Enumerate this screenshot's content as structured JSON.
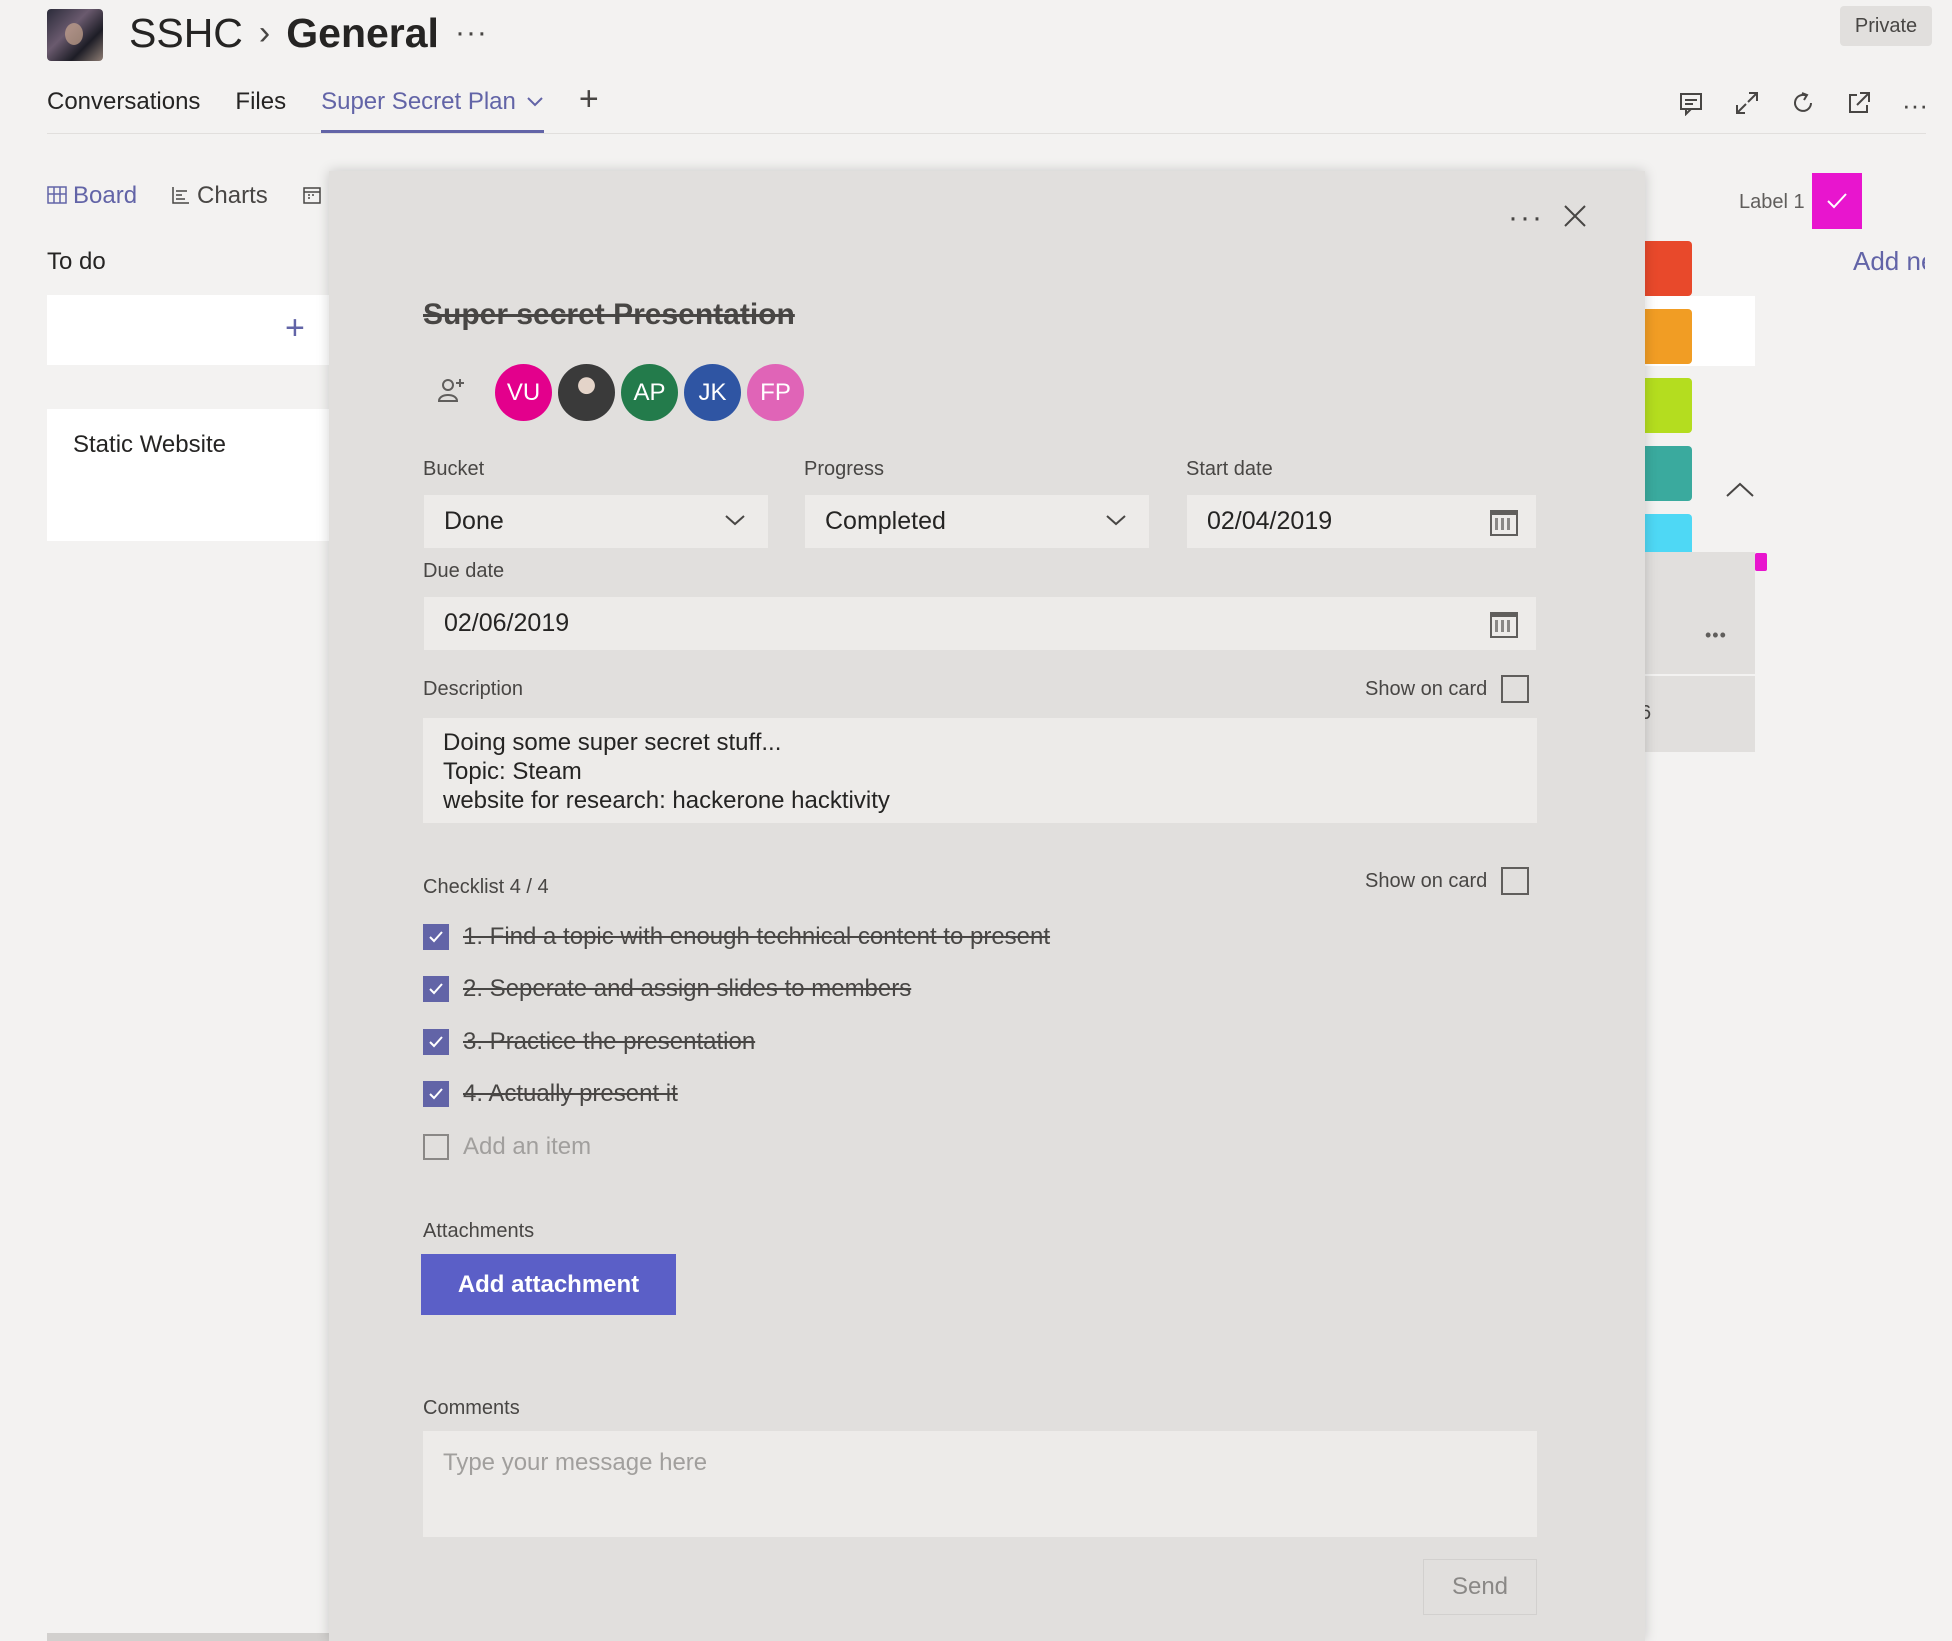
{
  "header": {
    "team": "SSHC",
    "channel": "General",
    "more": "···",
    "privacy": "Private"
  },
  "tabs": [
    {
      "label": "Conversations"
    },
    {
      "label": "Files"
    },
    {
      "label": "Super Secret Plan"
    }
  ],
  "header_icons": [
    "conversation-icon",
    "expand-icon",
    "refresh-icon",
    "popout-icon",
    "more-icon"
  ],
  "board": {
    "views": [
      {
        "label": "Board"
      },
      {
        "label": "Charts"
      }
    ],
    "bucket_title": "To do",
    "add_symbol": "+",
    "card_title": "Static Website",
    "label_name": "Label 1",
    "add_new": "Add ne",
    "card_number": "6",
    "label_colors": [
      "#e8492b",
      "#f19d24",
      "#b4dd1f",
      "#3aaa9e",
      "#4ed8f5"
    ],
    "accent_pink": "#e815ce"
  },
  "task": {
    "title": "Super secret Presentation",
    "assignees": [
      {
        "initials": "VU",
        "color": "#e3008c"
      },
      {
        "initials": "",
        "color": "#3a3a3a"
      },
      {
        "initials": "AP",
        "color": "#237b4b"
      },
      {
        "initials": "JK",
        "color": "#2f55a3"
      },
      {
        "initials": "FP",
        "color": "#e064b7"
      }
    ],
    "bucket": {
      "label": "Bucket",
      "value": "Done"
    },
    "progress": {
      "label": "Progress",
      "value": "Completed"
    },
    "start_date": {
      "label": "Start date",
      "value": "02/04/2019"
    },
    "due_date": {
      "label": "Due date",
      "value": "02/06/2019"
    },
    "description": {
      "label": "Description",
      "show_on_card": "Show on card",
      "lines": [
        "Doing some super secret stuff...",
        "Topic: Steam",
        "website for research: hackerone hacktivity"
      ]
    },
    "checklist": {
      "label": "Checklist 4 / 4",
      "show_on_card": "Show on card",
      "items": [
        {
          "text": "1. Find a topic with enough technical content to present",
          "checked": true
        },
        {
          "text": "2. Seperate and assign slides to members",
          "checked": true
        },
        {
          "text": "3. Practice the presentation",
          "checked": true
        },
        {
          "text": "4. Actually present it",
          "checked": true
        }
      ],
      "add_placeholder": "Add an item"
    },
    "attachments": {
      "label": "Attachments",
      "button": "Add attachment"
    },
    "comments": {
      "label": "Comments",
      "placeholder": "Type your message here",
      "send": "Send"
    }
  }
}
